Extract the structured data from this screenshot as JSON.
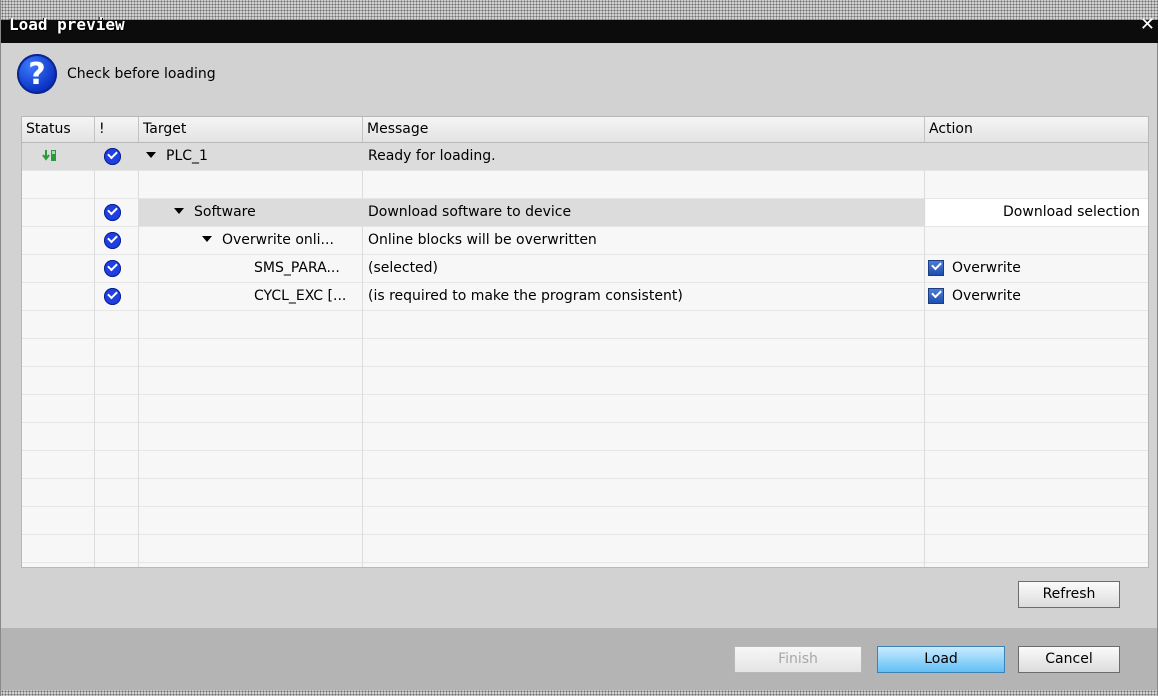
{
  "window": {
    "title": "Load preview"
  },
  "header": {
    "text": "Check before loading"
  },
  "table": {
    "columns": [
      "Status",
      "!",
      "Target",
      "Message",
      "Action"
    ],
    "rows": [
      {
        "target": "PLC_1",
        "message": "Ready for loading.",
        "action": ""
      },
      {
        "target": "Software",
        "message": "Download software to device",
        "action": "Download selection"
      },
      {
        "target": "Overwrite onli...",
        "message": "Online blocks will be overwritten",
        "action": ""
      },
      {
        "target": "SMS_PARA...",
        "message": "(selected)",
        "action": "Overwrite"
      },
      {
        "target": "CYCL_EXC [...",
        "message": "(is required to make the program consistent)",
        "action": "Overwrite"
      }
    ]
  },
  "buttons": {
    "refresh": "Refresh",
    "finish": "Finish",
    "load": "Load",
    "cancel": "Cancel"
  },
  "colors": {
    "accent": "#1f3fe0",
    "primary_button": "#62bff5",
    "status_icon": "#2a9a3a"
  }
}
